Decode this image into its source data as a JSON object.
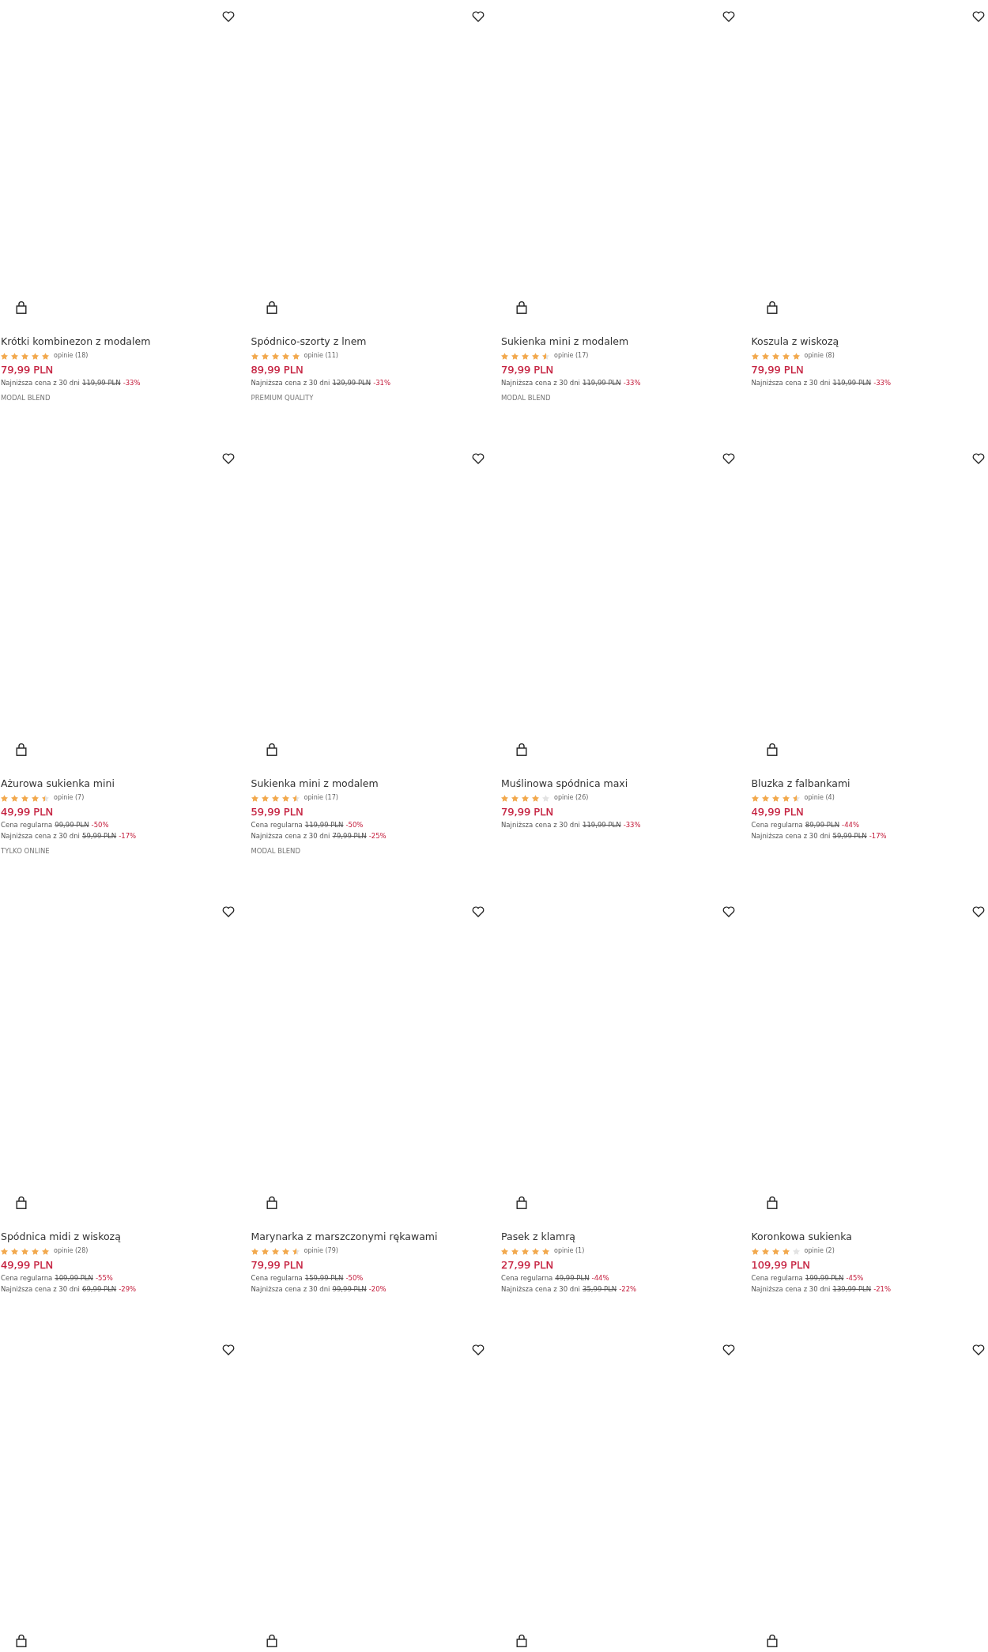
{
  "products": [
    {
      "wishlisted": false,
      "title": "Krótki kombinezon z modalem",
      "stars": 5,
      "reviews": "opinie (18)",
      "price": "79,99 PLN",
      "price_notes": [
        {
          "label": "Najniższa cena z 30 dni",
          "old_price": "119,99 PLN",
          "discount": "-33%"
        }
      ],
      "badge": "MODAL BLEND"
    },
    {
      "wishlisted": false,
      "title": "Spódnico-szorty z lnem",
      "stars": 5,
      "reviews": "opinie (11)",
      "price": "89,99 PLN",
      "price_notes": [
        {
          "label": "Najniższa cena z 30 dni",
          "old_price": "129,99 PLN",
          "discount": "-31%"
        }
      ],
      "badge": "PREMIUM QUALITY"
    },
    {
      "wishlisted": false,
      "title": "Sukienka mini z modalem",
      "stars": 4.5,
      "reviews": "opinie (17)",
      "price": "79,99 PLN",
      "price_notes": [
        {
          "label": "Najniższa cena z 30 dni",
          "old_price": "119,99 PLN",
          "discount": "-33%"
        }
      ],
      "badge": "MODAL BLEND"
    },
    {
      "wishlisted": false,
      "title": "Koszula z wiskozą",
      "stars": 5,
      "reviews": "opinie (8)",
      "price": "79,99 PLN",
      "price_notes": [
        {
          "label": "Najniższa cena z 30 dni",
          "old_price": "119,99 PLN",
          "discount": "-33%"
        }
      ]
    },
    {
      "wishlisted": false,
      "title": "Ażurowa sukienka mini",
      "stars": 4.5,
      "reviews": "opinie (7)",
      "price": "49,99 PLN",
      "price_notes": [
        {
          "label": "Cena regularna",
          "old_price": "99,99 PLN",
          "discount": "-50%"
        },
        {
          "label": "Najniższa cena z 30 dni",
          "old_price": "59,99 PLN",
          "discount": "-17%"
        }
      ],
      "badge": "TYLKO ONLINE"
    },
    {
      "wishlisted": false,
      "title": "Sukienka mini z modalem",
      "stars": 4.5,
      "reviews": "opinie (17)",
      "price": "59,99 PLN",
      "price_notes": [
        {
          "label": "Cena regularna",
          "old_price": "119,99 PLN",
          "discount": "-50%"
        },
        {
          "label": "Najniższa cena z 30 dni",
          "old_price": "79,99 PLN",
          "discount": "-25%"
        }
      ],
      "badge": "MODAL BLEND"
    },
    {
      "wishlisted": false,
      "title": "Muślinowa spódnica maxi",
      "stars": 4,
      "reviews": "opinie (26)",
      "price": "79,99 PLN",
      "price_notes": [
        {
          "label": "Najniższa cena z 30 dni",
          "old_price": "119,99 PLN",
          "discount": "-33%"
        }
      ]
    },
    {
      "wishlisted": false,
      "title": "Bluzka z falbankami",
      "stars": 4.5,
      "reviews": "opinie (4)",
      "price": "49,99 PLN",
      "price_notes": [
        {
          "label": "Cena regularna",
          "old_price": "89,99 PLN",
          "discount": "-44%"
        },
        {
          "label": "Najniższa cena z 30 dni",
          "old_price": "59,99 PLN",
          "discount": "-17%"
        }
      ]
    },
    {
      "wishlisted": false,
      "title": "Spódnica midi z wiskozą",
      "stars": 5,
      "reviews": "opinie (28)",
      "price": "49,99 PLN",
      "price_notes": [
        {
          "label": "Cena regularna",
          "old_price": "109,99 PLN",
          "discount": "-55%"
        },
        {
          "label": "Najniższa cena z 30 dni",
          "old_price": "69,99 PLN",
          "discount": "-29%"
        }
      ]
    },
    {
      "wishlisted": false,
      "title": "Marynarka z marszczonymi rękawami",
      "stars": 4.5,
      "reviews": "opinie (79)",
      "price": "79,99 PLN",
      "price_notes": [
        {
          "label": "Cena regularna",
          "old_price": "159,99 PLN",
          "discount": "-50%"
        },
        {
          "label": "Najniższa cena z 30 dni",
          "old_price": "99,99 PLN",
          "discount": "-20%"
        }
      ]
    },
    {
      "wishlisted": false,
      "title": "Pasek z klamrą",
      "stars": 5,
      "reviews": "opinie (1)",
      "price": "27,99 PLN",
      "price_notes": [
        {
          "label": "Cena regularna",
          "old_price": "49,99 PLN",
          "discount": "-44%"
        },
        {
          "label": "Najniższa cena z 30 dni",
          "old_price": "35,99 PLN",
          "discount": "-22%"
        }
      ]
    },
    {
      "wishlisted": false,
      "title": "Koronkowa sukienka",
      "stars": 4,
      "reviews": "opinie (2)",
      "price": "109,99 PLN",
      "price_notes": [
        {
          "label": "Cena regularna",
          "old_price": "199,99 PLN",
          "discount": "-45%"
        },
        {
          "label": "Najniższa cena z 30 dni",
          "old_price": "139,99 PLN",
          "discount": "-21%"
        }
      ]
    },
    {
      "wishlisted": false
    },
    {
      "wishlisted": false
    },
    {
      "wishlisted": false
    },
    {
      "wishlisted": false
    }
  ]
}
